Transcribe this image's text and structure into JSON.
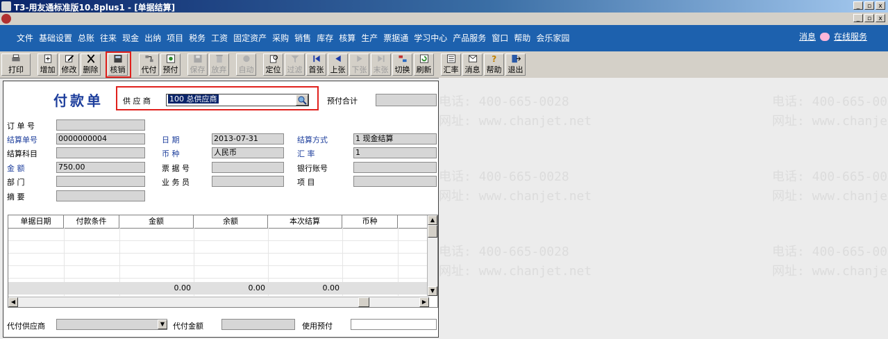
{
  "window": {
    "title": "T3-用友通标准版10.8plus1 - [单据结算]",
    "minimize": "_",
    "restore": "▫",
    "close": "x"
  },
  "menu": {
    "items": [
      "文件",
      "基础设置",
      "总账",
      "往来",
      "现金",
      "出纳",
      "项目",
      "税务",
      "工资",
      "固定资产",
      "采购",
      "销售",
      "库存",
      "核算",
      "生产",
      "票据通",
      "学习中心",
      "产品服务",
      "窗口",
      "帮助",
      "会乐家园"
    ],
    "message": "消息",
    "online_service": "在线服务"
  },
  "toolbar": {
    "print": "打印",
    "add": "增加",
    "modify": "修改",
    "delete": "删除",
    "writeoff": "核销",
    "agent_pay": "代付",
    "prepay": "预付",
    "save": "保存",
    "discard": "放弃",
    "auto": "自动",
    "locate": "定位",
    "filter": "过滤",
    "first": "首张",
    "prev": "上张",
    "next": "下张",
    "last": "末张",
    "switch": "切换",
    "refresh": "刷新",
    "exchange_rate": "汇率",
    "message": "消息",
    "help": "帮助",
    "exit": "退出"
  },
  "form": {
    "title": "付款单",
    "supplier_label": "供 应 商",
    "supplier_value": "100   总供应商",
    "prepay_total_label": "预付合计",
    "prepay_total_value": "",
    "order_no_label": "订 单 号",
    "order_no_value": "",
    "settle_no_label": "结算单号",
    "settle_no_value": "0000000004",
    "date_label": "日    期",
    "date_value": "2013-07-31",
    "settle_method_label": "结算方式",
    "settle_method_value": "1   现金结算",
    "settle_account_label": "结算科目",
    "settle_account_value": "",
    "currency_label": "币    种",
    "currency_value": "人民币",
    "rate_label": "汇    率",
    "rate_value": "1",
    "amount_label": "金    额",
    "amount_value": "750.00",
    "bill_no_label": "票 据 号",
    "bill_no_value": "",
    "bank_account_label": "银行账号",
    "bank_account_value": "",
    "dept_label": "部    门",
    "dept_value": "",
    "salesman_label": "业 务 员",
    "salesman_value": "",
    "project_label": "项    目",
    "project_value": "",
    "summary_label": "摘    要",
    "summary_value": "",
    "agent_supplier_label": "代付供应商",
    "agent_supplier_value": "",
    "agent_amount_label": "代付金额",
    "agent_amount_value": "",
    "use_prepay_label": "使用预付",
    "use_prepay_value": ""
  },
  "grid": {
    "columns": [
      "单据日期",
      "付款条件",
      "金额",
      "余额",
      "本次结算",
      "币种"
    ],
    "totals": [
      "0.00",
      "0.00",
      "0.00"
    ]
  },
  "watermark": {
    "phone": "电话: 400-665-0028",
    "site": "网址: www.chanjet.net"
  }
}
